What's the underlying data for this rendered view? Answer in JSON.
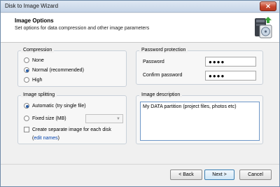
{
  "window": {
    "title": "Disk to Image Wizard",
    "close_glyph": "✕"
  },
  "header": {
    "title": "Image Options",
    "subtitle": "Set options for data compression and other image parameters",
    "icon": "drive-image-icon"
  },
  "compression": {
    "title": "Compression",
    "options": [
      "None",
      "Normal (recommended)",
      "High"
    ],
    "selected": "Normal (recommended)"
  },
  "password": {
    "title": "Password protection",
    "password_label": "Password",
    "password_value": "●●●●",
    "confirm_label": "Confirm password",
    "confirm_value": "●●●●"
  },
  "splitting": {
    "title": "Image splitting",
    "automatic_label": "Automatic (try single file)",
    "fixed_label": "Fixed size (MB)",
    "fixed_value": "",
    "selected": "Automatic (try single file)",
    "separate_label": "Create separate image for each disk",
    "separate_checked": false,
    "edit_names_open": "(",
    "edit_names_link": "edit names",
    "edit_names_close": ")"
  },
  "description": {
    "title": "Image description",
    "value": "My DATA partition (project files, photos etc)"
  },
  "buttons": {
    "back": "< Back",
    "next": "Next >",
    "cancel": "Cancel"
  },
  "colors": {
    "accent": "#2b5fa8",
    "link": "#0645ad",
    "close": "#c6452c"
  }
}
